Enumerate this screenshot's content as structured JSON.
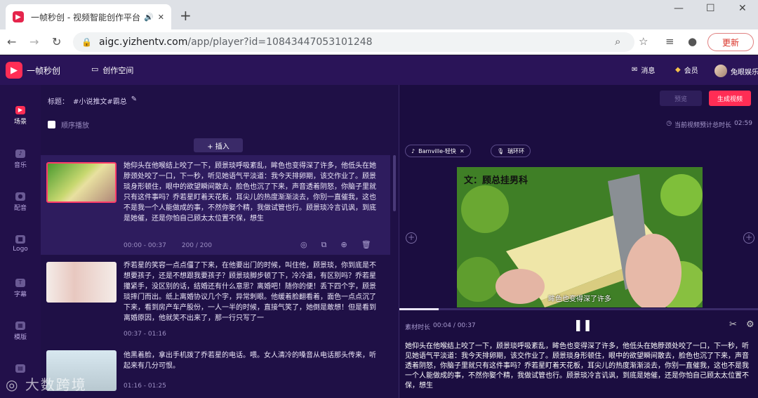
{
  "browser": {
    "tab_title": "一帧秒创 - 视频智能创作平台",
    "url_host": "aigc.yizhentv.com",
    "url_path": "/app/player?id=10843447053101248",
    "update_label": "更新"
  },
  "header": {
    "brand": "一帧秒创",
    "workspace": "创作空间",
    "messages": "消息",
    "member": "会员",
    "user": "兔眼娱乐"
  },
  "sidebar": {
    "items": [
      {
        "label": "场景"
      },
      {
        "label": "音乐"
      },
      {
        "label": "配音"
      },
      {
        "label": "Logo"
      },
      {
        "label": "字幕"
      },
      {
        "label": "模版"
      }
    ]
  },
  "editor": {
    "title_label": "标题：",
    "title_value": "#小说推文#霸总",
    "sequential_play": "顺序播放",
    "insert_label": "+ 插入"
  },
  "clips": [
    {
      "text": "她仰头在他喉结上咬了一下，顾景琰呼吸紊乱，眸色也变得深了许多，他低头在她脖颈处咬了一口，下一秒，听见她语气平淡道：我今天排卵期，该交作业了。顾景琰身形顿住，眼中的欲望瞬间散去，脸色也沉了下来，声音透着阴怒，你脑子里就只有这件事吗？乔若星盯着天花板，耳尖儿的热度渐渐淡去，你别一直催我，这也不是我一个人能做成的事，不然你娶个精，我做试管也行。顾景琰冷言讥讽，到底是她催，还是你怕自己顾太太位置不保，想生",
      "time": "00:00 - 00:37",
      "count": "200 / 200"
    },
    {
      "text": "乔若星的笑容一点点僵了下来，在他要出门的时候，叫住他，顾景琰，你到底是不想要孩子，还是不想跟我要孩子？顾景琰脚步顿了下，冷冷道，有区别吗？乔若星攥紧手，没区别的话，结婚还有什么意思？离婚吧！随你的便！丢下四个字，顾景琰摔门而出。纸上离婚协议几个字，异常刺眼。他缓着脸翻看着，面色一点点沉了下来，看到房产车产股份，一人一半的时候，直接气笑了，她倒是敢想！但是看到离婚原因，他就笑不出来了，那一行只写了一",
      "time": "00:37 - 01:16",
      "count": ""
    },
    {
      "text": "他黑着脸，拿出手机拨了乔若星的电话。喂。女人清冷的嗓音从电话那头传来，听起来有几分可恨。",
      "time": "01:16 - 01:25",
      "count": ""
    }
  ],
  "right": {
    "preview_label": "预览",
    "generate_label": "生成视频",
    "est_label": "当前视频预计总时长",
    "est_value": "02:59",
    "music_tag": "Barnville-轻快",
    "voice_tag": "瑞环环",
    "video_caption_top": "文：顾总挂男科",
    "video_subtitle": "眸色也变得深了许多",
    "material_label": "素材时长",
    "material_value": "00:04 / 00:37",
    "progress_fraction": 0.11,
    "current_text": "她仰头在他喉结上咬了一下，顾景琰呼吸紊乱，眸色也变得深了许多，他低头在她脖颈处咬了一口，下一秒，听见她语气平淡道：我今天排卵期，该交作业了。顾景琰身形顿住，眼中的欲望瞬间散去，脸色也沉了下来，声音透着阴怒，你脑子里就只有这件事吗？乔若星盯着天花板，耳尖儿的热度渐渐淡去，你别一直催我，这也不是我一个人能做成的事，不然你娶个精，我做试管也行。顾景琰冷言讥讽，到底是她催，还是你怕自己顾太太位置不保，想生"
  },
  "watermark": "大数跨境",
  "colors": {
    "accent": "#ff2d55",
    "bg_dark": "#1a0f35",
    "header": "#2a1458"
  }
}
